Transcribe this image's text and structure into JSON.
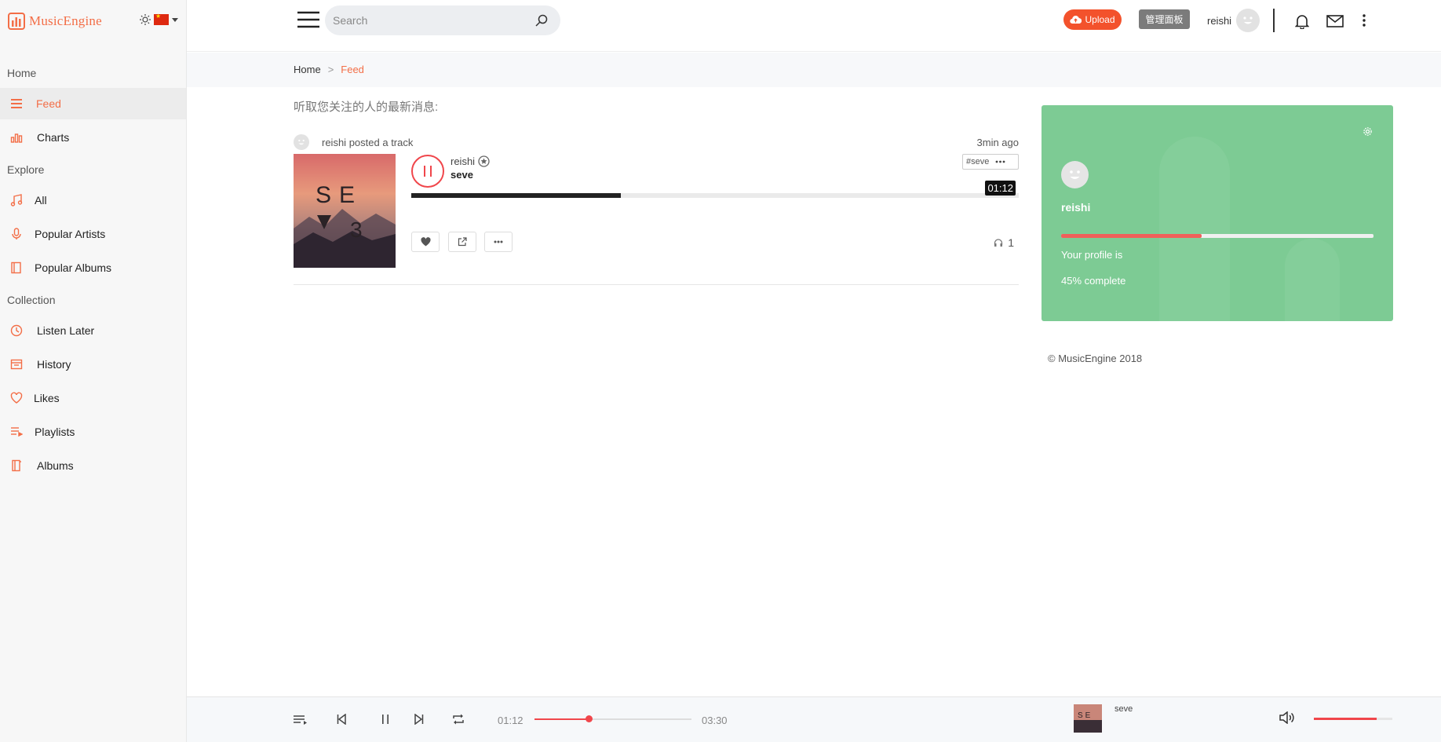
{
  "app": {
    "brand": "MusicEngine"
  },
  "sidebar": {
    "sections": [
      {
        "title": "Home",
        "items": [
          {
            "label": "Feed",
            "icon": "feed-icon",
            "active": true
          },
          {
            "label": "Charts",
            "icon": "charts-icon"
          }
        ]
      },
      {
        "title": "Explore",
        "items": [
          {
            "label": "All",
            "icon": "music-note-icon"
          },
          {
            "label": "Popular Artists",
            "icon": "microphone-icon"
          },
          {
            "label": "Popular Albums",
            "icon": "album-icon"
          }
        ]
      },
      {
        "title": "Collection",
        "items": [
          {
            "label": "Listen Later",
            "icon": "clock-icon"
          },
          {
            "label": "History",
            "icon": "history-icon"
          },
          {
            "label": "Likes",
            "icon": "heart-icon"
          },
          {
            "label": "Playlists",
            "icon": "playlist-icon"
          },
          {
            "label": "Albums",
            "icon": "albums-icon"
          }
        ]
      }
    ]
  },
  "header": {
    "search_placeholder": "Search",
    "upload_label": "Upload",
    "admin_label": "管理面板",
    "username": "reishi"
  },
  "breadcrumb": {
    "home": "Home",
    "separator": ">",
    "current": "Feed"
  },
  "feed": {
    "heading": "听取您关注的人的最新消息:",
    "posts": [
      {
        "actor": "reishi",
        "action": "posted a track",
        "time_ago": "3min ago",
        "artist": "reishi",
        "title": "seve",
        "tag": "#seve",
        "current_time": "01:12",
        "progress": 0.345,
        "listens": "1"
      }
    ]
  },
  "profile_card": {
    "name": "reishi",
    "line1": "Your profile is",
    "line2": "45% complete",
    "completion": 0.45
  },
  "footer": {
    "copyright": "© MusicEngine 2018"
  },
  "player": {
    "current_time": "01:12",
    "total_time": "03:30",
    "progress": 0.345,
    "track_title": "seve",
    "volume": 0.8
  },
  "colors": {
    "accent": "#f36e47",
    "upload": "#f3522c",
    "card": "#7dcb94",
    "play_red": "#f0464b"
  }
}
